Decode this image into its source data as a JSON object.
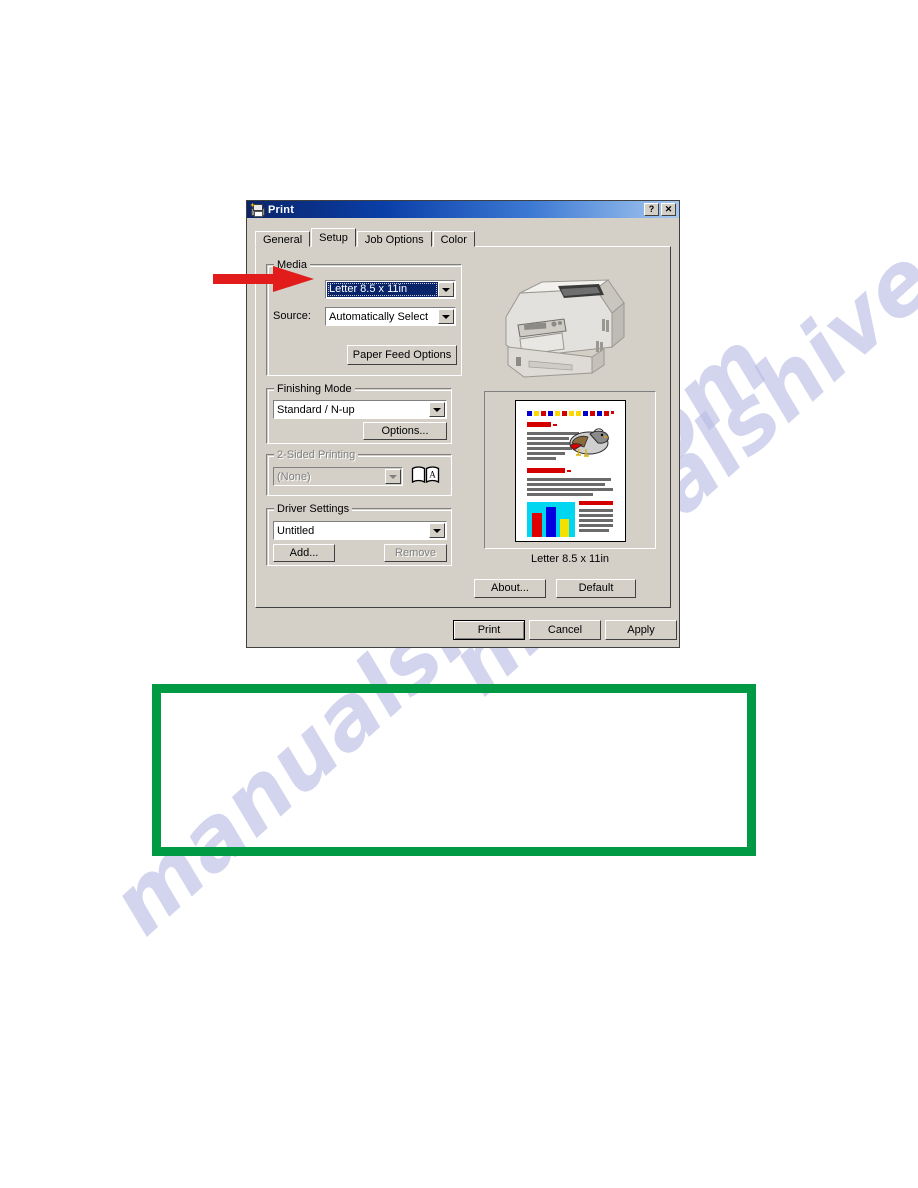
{
  "watermark": {
    "text": "manualshive.com"
  },
  "dialog": {
    "title": "Print",
    "icon": "printer-icon",
    "help_button": "?",
    "close_button": "✕",
    "tabs": [
      {
        "label": "General",
        "active": false
      },
      {
        "label": "Setup",
        "active": true
      },
      {
        "label": "Job Options",
        "active": false
      },
      {
        "label": "Color",
        "active": false
      }
    ],
    "groups": {
      "media": {
        "legend": "Media",
        "size_value": "Letter 8.5 x 11in",
        "source_label": "Source:",
        "source_value": "Automatically Select",
        "paper_feed_button": "Paper Feed Options"
      },
      "finishing": {
        "legend": "Finishing Mode",
        "mode_value": "Standard / N-up",
        "options_button": "Options..."
      },
      "two_sided": {
        "legend": "2-Sided Printing",
        "value": "(None)",
        "disabled": true,
        "book_icon": "open-book-icon"
      },
      "driver_settings": {
        "legend": "Driver Settings",
        "value": "Untitled",
        "add_button": "Add...",
        "remove_button": "Remove",
        "remove_disabled": true
      }
    },
    "preview": {
      "printer_image_alt": "printer-illustration",
      "caption": "Letter 8.5 x 11in"
    },
    "buttons": {
      "about": "About...",
      "default": "Default",
      "print": "Print",
      "cancel": "Cancel",
      "apply": "Apply"
    }
  },
  "note_box": {
    "content": ""
  },
  "colors": {
    "title_gradient_start": "#0a246a",
    "title_gradient_end": "#a6c8ef",
    "dialog_face": "#d4d0c8",
    "selection_blue": "#0a246a",
    "arrow_red": "#e21b1b",
    "note_border_green": "#009a44",
    "watermark_blue": "#b9bce4"
  }
}
